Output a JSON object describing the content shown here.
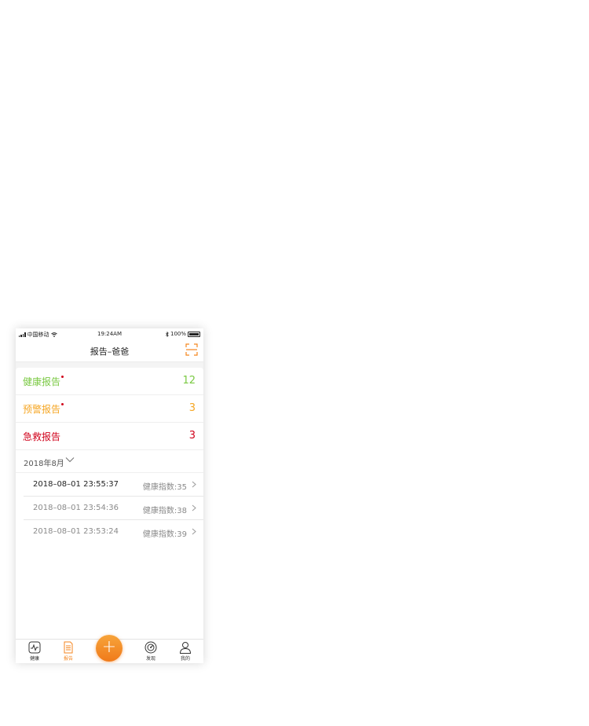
{
  "status_bar": {
    "carrier": "中国移动",
    "time": "19:24AM",
    "battery": "100%"
  },
  "header": {
    "title": "报告–爸爸",
    "scan_icon": "scan-icon"
  },
  "reports": [
    {
      "label": "健康报告",
      "count": "12",
      "color": "#7ac943",
      "has_dot": true
    },
    {
      "label": "预警报告",
      "count": "3",
      "color": "#f5a623",
      "has_dot": true
    },
    {
      "label": "急救报告",
      "count": "3",
      "color": "#d0021b",
      "has_dot": false
    }
  ],
  "month_filter": {
    "label": "2018年8月"
  },
  "records": [
    {
      "datetime": "2018–08–01 23:55:37",
      "score": "健康指数:35",
      "color": "#222222"
    },
    {
      "datetime": "2018–08–01 23:54:36",
      "score": "健康指数:38",
      "color": "#8a8a8a"
    },
    {
      "datetime": "2018–08–01 23:53:24",
      "score": "健康指数:39",
      "color": "#8a8a8a"
    }
  ],
  "tabbar": {
    "items": [
      {
        "label": "健康",
        "icon": "heart-monitor-icon",
        "active": false
      },
      {
        "label": "报告",
        "icon": "report-document-icon",
        "active": true
      },
      {
        "label": "",
        "icon": "plus-icon",
        "active": false
      },
      {
        "label": "发现",
        "icon": "compass-icon",
        "active": false
      },
      {
        "label": "我的",
        "icon": "user-icon",
        "active": false
      }
    ],
    "plus_symbol": "+"
  },
  "colors": {
    "accent": "#f5861f",
    "healthy": "#7ac943",
    "warning": "#f5a623",
    "emergency": "#d0021b"
  }
}
